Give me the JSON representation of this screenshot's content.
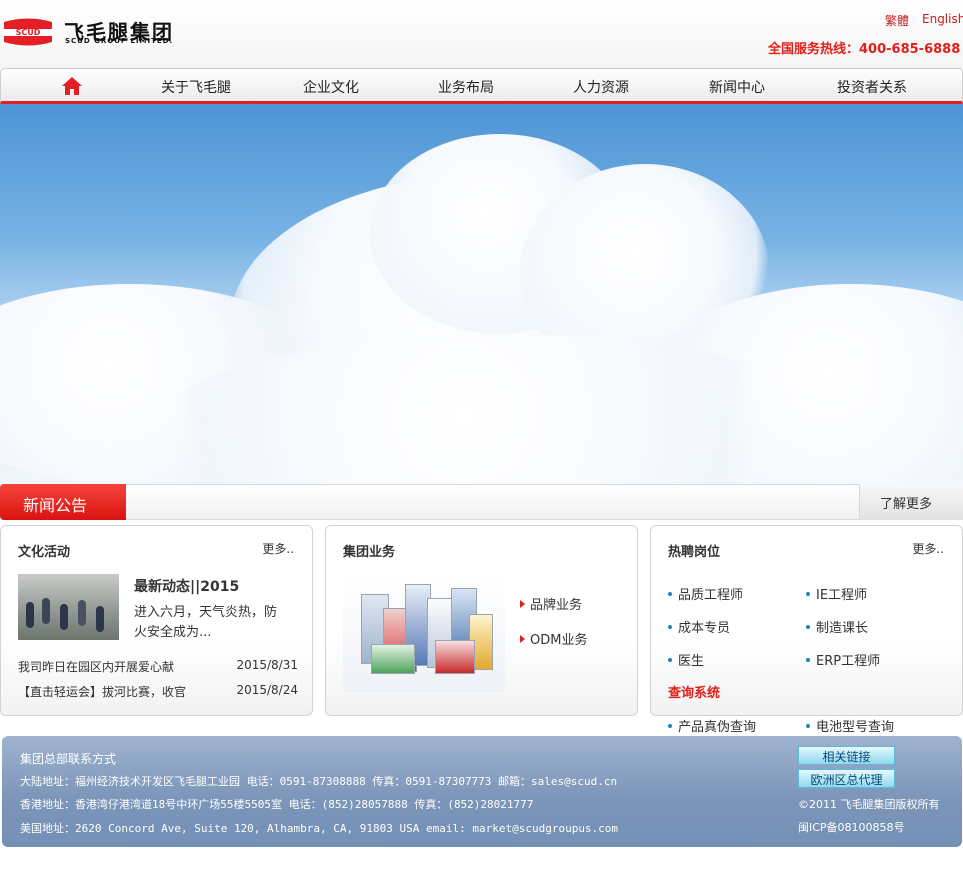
{
  "header": {
    "logo_cn": "飞毛腿集团",
    "logo_en": "SCUD GROUP LIMITED.",
    "logo_badge": "SCUD",
    "lang_tc": "繁體",
    "lang_en": "English",
    "hotline_label": "全国服务热线：400-685-6888"
  },
  "nav": {
    "home_icon": "home-icon",
    "items": [
      "关于飞毛腿",
      "企业文化",
      "业务布局",
      "人力资源",
      "新闻中心",
      "投资者关系"
    ]
  },
  "newsbar": {
    "tag": "新闻公告",
    "more": "了解更多"
  },
  "culture": {
    "title": "文化活动",
    "more": "更多..",
    "headline": "最新动态||2015",
    "summary": "进入六月，天气炎热，防火安全成为...",
    "rows": [
      {
        "title": "我司昨日在园区内开展爱心献",
        "date": "2015/8/31"
      },
      {
        "title": "【直击轻运会】拔河比赛，收官",
        "date": "2015/8/24"
      }
    ]
  },
  "business": {
    "title": "集团业务",
    "links": [
      "品牌业务",
      "ODM业务"
    ]
  },
  "jobs": {
    "title": "热聘岗位",
    "more": "更多..",
    "items": [
      "品质工程师",
      "IE工程师",
      "成本专员",
      "制造课长",
      "医生",
      "ERP工程师"
    ],
    "query_title": "查询系统",
    "queries": [
      "产品真伪查询",
      "电池型号查询"
    ]
  },
  "footer": {
    "title": "集团总部联系方式",
    "lines": [
      "大陆地址：福州经济技术开发区飞毛腿工业园  电话：0591-87308888  传真：0591-87307773 邮箱：sales@scud.cn",
      "香港地址：香港湾仔港湾道18号中环广场55楼5505室  电话：(852)28057888  传真：(852)28021777",
      "美国地址：2620 Concord Ave, Suite 120, Alhambra, CA, 91803 USA email: market@scudgroupus.com"
    ],
    "buttons": [
      "相关链接",
      "欧洲区总代理"
    ],
    "copyright": "©2011 飞毛腿集团版权所有",
    "icp": "闽ICP备08100858号"
  },
  "colors": {
    "brand_red": "#e41e25",
    "footer_blue": "#7d96b9",
    "bullet_blue": "#1f7fc4"
  }
}
